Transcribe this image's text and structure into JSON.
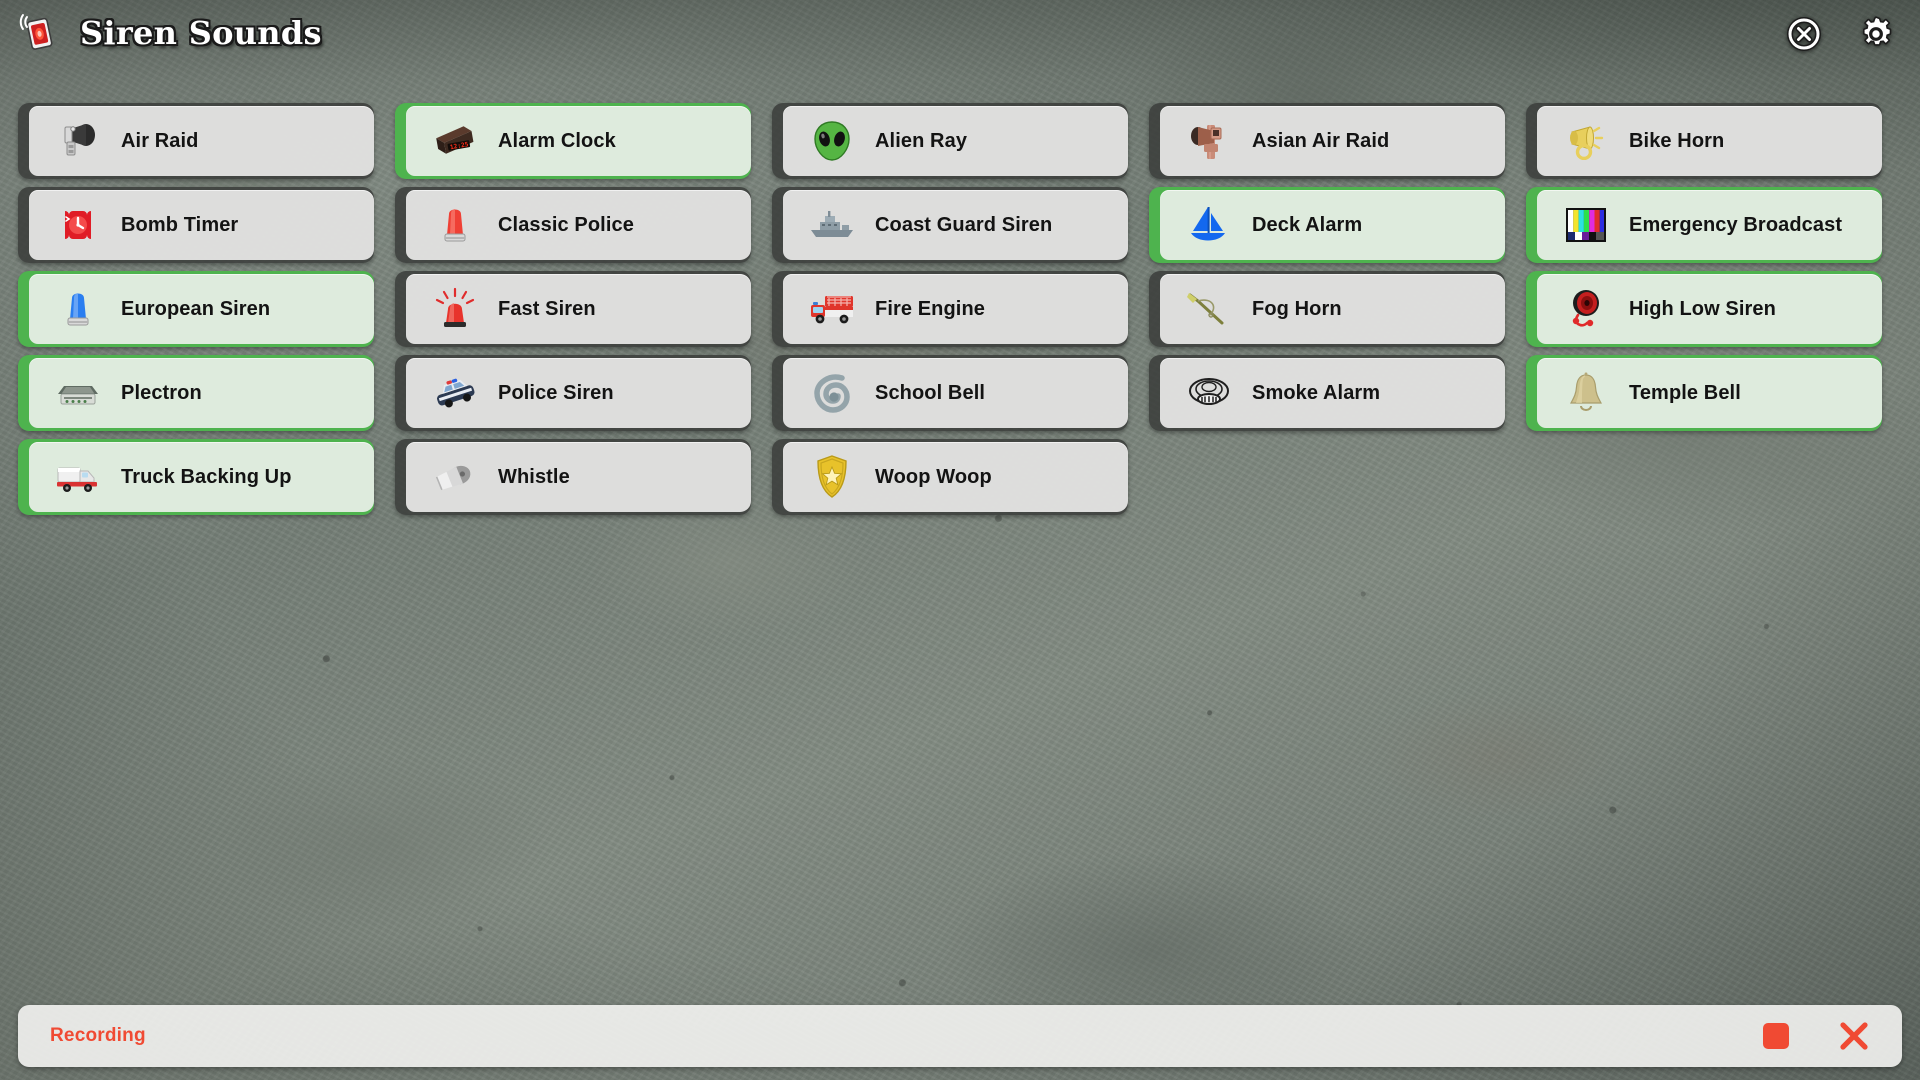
{
  "app": {
    "title": "Siren Sounds",
    "icon": "siren-light-icon"
  },
  "header": {
    "close_label": "Close",
    "close_icon": "close-circle-icon",
    "settings_label": "Settings",
    "settings_icon": "gear-icon"
  },
  "colors": {
    "active_strip": "#4eb34e",
    "inactive_strip": "#3a3c3a",
    "button_face": "#f3f3f1",
    "recording_text": "#f04a33",
    "label_text": "#131313",
    "background": "#79847d"
  },
  "sounds": [
    {
      "label": "Air Raid",
      "icon": "air-raid-siren-icon",
      "active": false
    },
    {
      "label": "Alarm Clock",
      "icon": "alarm-clock-radio-icon",
      "active": true
    },
    {
      "label": "Alien Ray",
      "icon": "alien-head-icon",
      "active": false
    },
    {
      "label": "Asian Air Raid",
      "icon": "horn-speaker-icon",
      "active": false
    },
    {
      "label": "Bike Horn",
      "icon": "bike-horn-icon",
      "active": false
    },
    {
      "label": "Bomb Timer",
      "icon": "bomb-timer-clock-icon",
      "active": false
    },
    {
      "label": "Classic Police",
      "icon": "red-beacon-light-icon",
      "active": false
    },
    {
      "label": "Coast Guard Siren",
      "icon": "ship-icon",
      "active": false
    },
    {
      "label": "Deck Alarm",
      "icon": "sailboat-icon",
      "active": true
    },
    {
      "label": "Emergency Broadcast",
      "icon": "tv-color-bars-icon",
      "active": true
    },
    {
      "label": "European Siren",
      "icon": "blue-beacon-light-icon",
      "active": true
    },
    {
      "label": "Fast Siren",
      "icon": "flashing-red-light-icon",
      "active": false
    },
    {
      "label": "Fire Engine",
      "icon": "fire-truck-icon",
      "active": false
    },
    {
      "label": "Fog Horn",
      "icon": "fog-horn-icon",
      "active": false
    },
    {
      "label": "High Low Siren",
      "icon": "round-siren-speaker-icon",
      "active": true
    },
    {
      "label": "Plectron",
      "icon": "plectron-receiver-icon",
      "active": true
    },
    {
      "label": "Police Siren",
      "icon": "police-car-icon",
      "active": false
    },
    {
      "label": "School Bell",
      "icon": "school-bell-spiral-icon",
      "active": false
    },
    {
      "label": "Smoke Alarm",
      "icon": "smoke-detector-icon",
      "active": false
    },
    {
      "label": "Temple Bell",
      "icon": "temple-bell-icon",
      "active": true
    },
    {
      "label": "Truck Backing Up",
      "icon": "truck-icon",
      "active": true
    },
    {
      "label": "Whistle",
      "icon": "whistle-icon",
      "active": false
    },
    {
      "label": "Woop Woop",
      "icon": "police-badge-icon",
      "active": false
    }
  ],
  "recording": {
    "status": "Recording",
    "stop_label": "Stop",
    "stop_icon": "stop-square-icon",
    "cancel_label": "Cancel",
    "cancel_icon": "x-icon"
  }
}
